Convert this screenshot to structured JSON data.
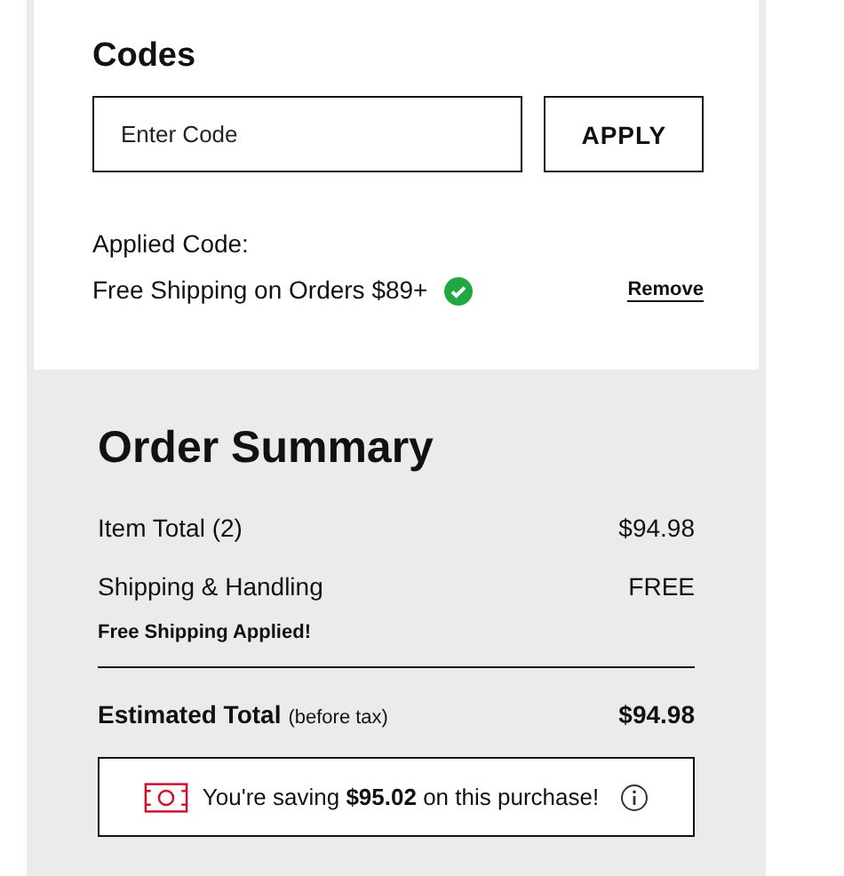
{
  "codes": {
    "title": "Codes",
    "input": {
      "placeholder": "Enter Code"
    },
    "apply_button": "APPLY",
    "applied_label": "Applied Code:",
    "applied_code": {
      "text": "Free Shipping on Orders $89+",
      "valid": true
    },
    "remove_link": "Remove"
  },
  "order_summary": {
    "title": "Order Summary",
    "rows": [
      {
        "label": "Item Total (2)",
        "value": "$94.98"
      },
      {
        "label": "Shipping & Handling",
        "value": "FREE"
      }
    ],
    "shipping_note": "Free Shipping Applied!",
    "total": {
      "label": "Estimated Total",
      "note": "(before tax)",
      "value": "$94.98"
    },
    "savings": "You're saving **$95.02** on this purchase!"
  }
}
